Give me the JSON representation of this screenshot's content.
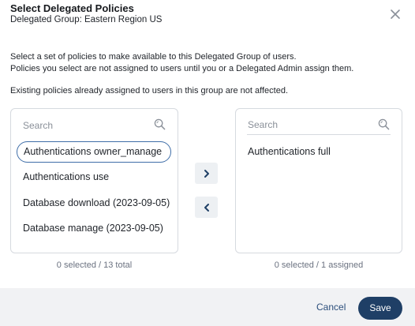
{
  "dialog": {
    "title": "Select Delegated Policies",
    "subtitle": "Delegated Group: Eastern Region US",
    "close_icon": "close-icon",
    "description": [
      "Select a set of policies to make available to this Delegated Group of users.",
      "Policies you select are not assigned to users until you or a Delegated Admin assign them.",
      "Existing policies already assigned to users in this group are not affected."
    ]
  },
  "available": {
    "search_placeholder": "Search",
    "search_icon": "search-icon",
    "items": [
      "Authentications owner_manage",
      "Authentications use",
      "Database download (2023-09-05)",
      "Database manage (2023-09-05)"
    ],
    "count_text": "0 selected / 13 total"
  },
  "assigned": {
    "search_placeholder": "Search",
    "search_icon": "search-icon",
    "items": [
      "Authentications full"
    ],
    "count_text": "0 selected / 1 assigned"
  },
  "transfer": {
    "add_icon": "chevron-right-icon",
    "remove_icon": "chevron-left-icon"
  },
  "footer": {
    "cancel_label": "Cancel",
    "save_label": "Save"
  },
  "colors": {
    "primary": "#1f3f66",
    "link": "#2c4f7c",
    "focus_ring": "#3f6ea8",
    "footer_bg": "#f1f2f4"
  }
}
